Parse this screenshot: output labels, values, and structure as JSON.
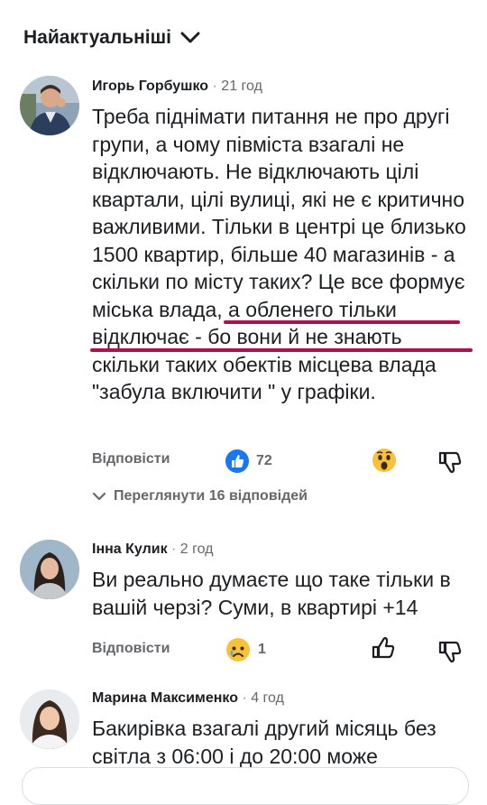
{
  "sort": {
    "label": "Найактуальніші"
  },
  "comments": [
    {
      "author": "Игорь Горбушко",
      "time": "21 год",
      "text_before": "Треба піднімати питання не про другі групи, а чому півміста взагалі не відключають. Не відключають цілі квартали, цілі вулиці, які не є критично  важливими. Тільки в центрі це близько 1500 квартир, більше 40 магазинів - а скільки по місту таких? ",
      "text_highlight": "Це все формує міська влада, а обленего тільки відключає",
      "text_after": " - бо вони й не знають скільки таких обектів місцева влада \"забула включити \" у графіки.",
      "reply_label": "Відповісти",
      "reaction_count": "72",
      "view_replies": "Переглянути 16 відповідей"
    },
    {
      "author": "Інна Кулик",
      "time": "2 год",
      "text": "Ви реально думаєте що таке тільки в вашій черзі? Суми, в квартирі +14",
      "reply_label": "Відповісти",
      "reaction_count": "1"
    },
    {
      "author": "Марина Максименко",
      "time": "4 год",
      "text": "Бакирівка взагалі другий місяць без світла з 06:00 і до 20:00 може"
    }
  ],
  "colors": {
    "text": "#1c1e21",
    "secondary": "#65676b",
    "like_blue": "#1877f2",
    "highlight_underline": "#b0104f"
  },
  "icons": [
    "chevron-down-icon",
    "like-reaction-icon",
    "wow-reaction-icon",
    "sad-reaction-icon",
    "thumbs-up-icon",
    "thumbs-down-icon"
  ]
}
